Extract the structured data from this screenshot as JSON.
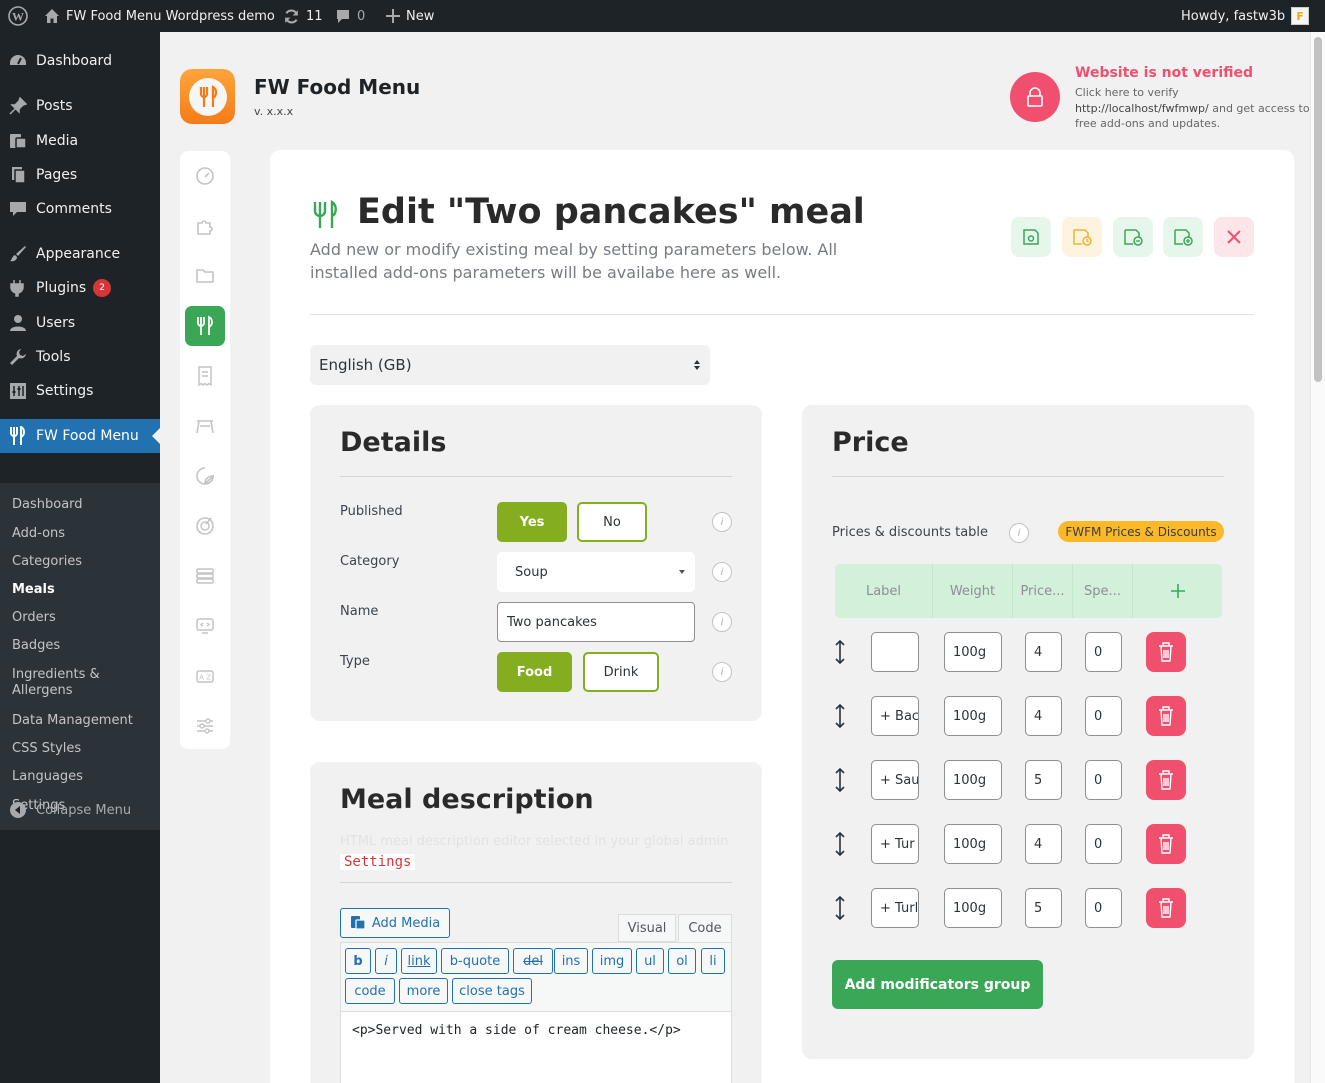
{
  "adminbar": {
    "site_name": "FW Food Menu Wordpress demo",
    "updates_count": "11",
    "comments_count": "0",
    "new_label": "New",
    "howdy": "Howdy, fastw3b"
  },
  "sidebar": {
    "items": [
      {
        "label": "Dashboard",
        "icon": "dashboard-icon"
      },
      {
        "label": "Posts",
        "icon": "pin-icon"
      },
      {
        "label": "Media",
        "icon": "media-icon"
      },
      {
        "label": "Pages",
        "icon": "pages-icon"
      },
      {
        "label": "Comments",
        "icon": "comments-icon"
      },
      {
        "label": "Appearance",
        "icon": "brush-icon"
      },
      {
        "label": "Plugins",
        "icon": "plugin-icon",
        "badge": "2"
      },
      {
        "label": "Users",
        "icon": "users-icon"
      },
      {
        "label": "Tools",
        "icon": "wrench-icon"
      },
      {
        "label": "Settings",
        "icon": "settings-icon"
      },
      {
        "label": "FW Food Menu",
        "icon": "fork-knife-icon"
      }
    ],
    "submenu": [
      "Dashboard",
      "Add-ons",
      "Categories",
      "Meals",
      "Orders",
      "Badges",
      "Ingredients & Allergens",
      "Data Management",
      "CSS Styles",
      "Languages",
      "Settings"
    ],
    "current_submenu": "Meals",
    "collapse_label": "Collapse Menu"
  },
  "app": {
    "title": "FW Food Menu",
    "version": "v. x.x.x",
    "verify_title": "Website is not verified",
    "verify_line1": "Click here to verify",
    "verify_url": "http://localhost/fwfmwp/",
    "verify_rest": "and get access to free add-ons and updates.",
    "accent_green": "#3aa757",
    "accent_olive": "#84ad1f",
    "danger_pink": "#f0506e"
  },
  "page": {
    "title": "Edit \"Two pancakes\" meal",
    "subtitle": "Add new or modify existing meal by setting parameters below. All installed add-ons parameters will be availabe here as well.",
    "language": "English (GB)"
  },
  "details": {
    "heading": "Details",
    "published_label": "Published",
    "yes": "Yes",
    "no": "No",
    "category_label": "Category",
    "category_value": "Soup",
    "name_label": "Name",
    "name_value": "Two pancakes",
    "type_label": "Type",
    "food": "Food",
    "drink": "Drink"
  },
  "description": {
    "heading": "Meal description",
    "placeholder": "HTML meal description editor selected in your global admin",
    "settings_code": "Settings",
    "add_media": "Add Media",
    "tab_visual": "Visual",
    "tab_code": "Code",
    "quicktags": [
      "b",
      "i",
      "link",
      "b-quote",
      "del",
      "ins",
      "img",
      "ul",
      "ol",
      "li",
      "code",
      "more",
      "close tags"
    ],
    "content": "<p>Served with a side of cream cheese.</p>"
  },
  "price": {
    "heading": "Price",
    "table_label": "Prices & discounts table",
    "addon_pill": "FWFM Prices & Discounts",
    "columns": [
      "Label",
      "Weight",
      "Price...",
      "Spe..."
    ],
    "rows": [
      {
        "label": "",
        "weight": "100g",
        "price": "4",
        "special": "0"
      },
      {
        "label": "+ Bac",
        "weight": "100g",
        "price": "4",
        "special": "0"
      },
      {
        "label": "+ Sau",
        "weight": "100g",
        "price": "5",
        "special": "0"
      },
      {
        "label": "+ Tur",
        "weight": "100g",
        "price": "4",
        "special": "0"
      },
      {
        "label": "+ Turl",
        "weight": "100g",
        "price": "5",
        "special": "0"
      }
    ],
    "add_group": "Add modificators group"
  }
}
